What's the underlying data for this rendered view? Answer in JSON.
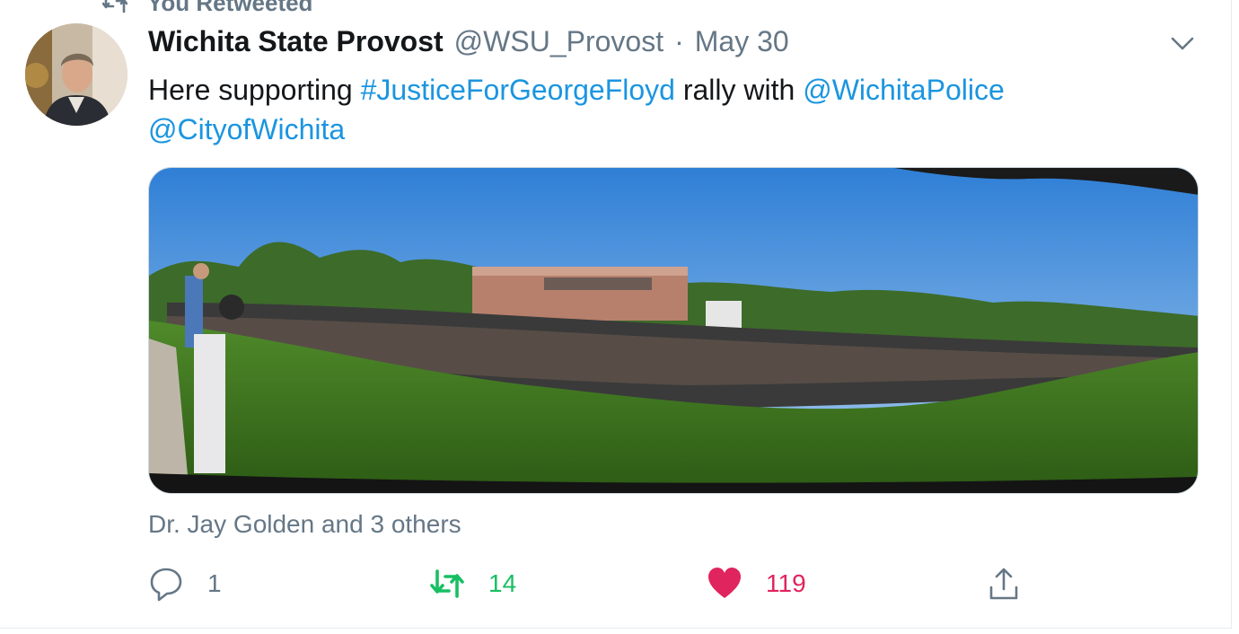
{
  "retweet_context": {
    "label": "You Retweeted"
  },
  "tweet": {
    "author_name": "Wichita State Provost",
    "handle": "@WSU_Provost",
    "separator": "·",
    "date": "May 30",
    "text_plain_1": "Here supporting ",
    "hashtag": "#JusticeForGeorgeFloyd",
    "text_plain_2": " rally with ",
    "mention_1": "@WichitaPolice",
    "mention_2": "@CityofWichita",
    "liked_by": "Dr. Jay Golden and 3 others"
  },
  "actions": {
    "reply_count": "1",
    "retweet_count": "14",
    "like_count": "119"
  },
  "colors": {
    "link": "#1b95e0",
    "secondary_text": "#657786",
    "retweet_active": "#17bf63",
    "like_active": "#e0245e"
  },
  "icons": [
    "retweet-context-icon",
    "chevron-down-icon",
    "reply-icon",
    "retweet-icon",
    "heart-icon",
    "share-icon"
  ]
}
